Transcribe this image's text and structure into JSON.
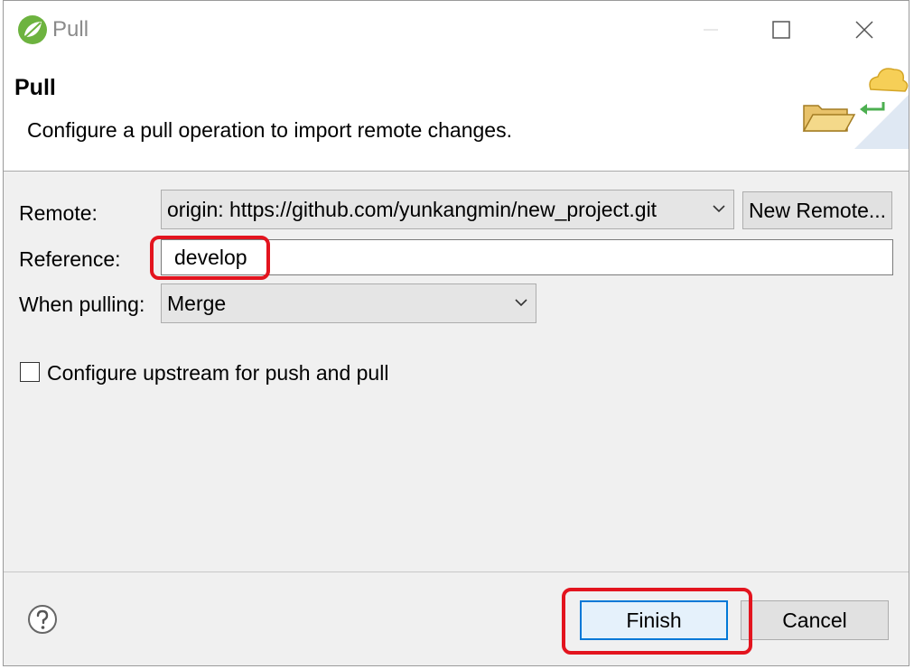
{
  "window": {
    "title": "Pull"
  },
  "banner": {
    "title": "Pull",
    "description": "Configure a pull operation to import remote changes."
  },
  "form": {
    "remote_label": "Remote:",
    "remote_value": "origin: https://github.com/yunkangmin/new_project.git",
    "new_remote_label": "New Remote...",
    "reference_label": "Reference:",
    "reference_value": "develop",
    "when_pulling_label": "When pulling:",
    "when_pulling_value": "Merge",
    "upstream_checkbox_label": "Configure upstream for push and pull",
    "upstream_checked": false
  },
  "footer": {
    "finish_label": "Finish",
    "cancel_label": "Cancel"
  },
  "colors": {
    "highlight": "#e3141e",
    "focus_border": "#0078d7"
  },
  "icons": [
    "spring-app-icon",
    "minimize-icon",
    "maximize-icon",
    "close-icon",
    "git-pull-banner-icon",
    "chevron-down-icon",
    "help-icon"
  ]
}
